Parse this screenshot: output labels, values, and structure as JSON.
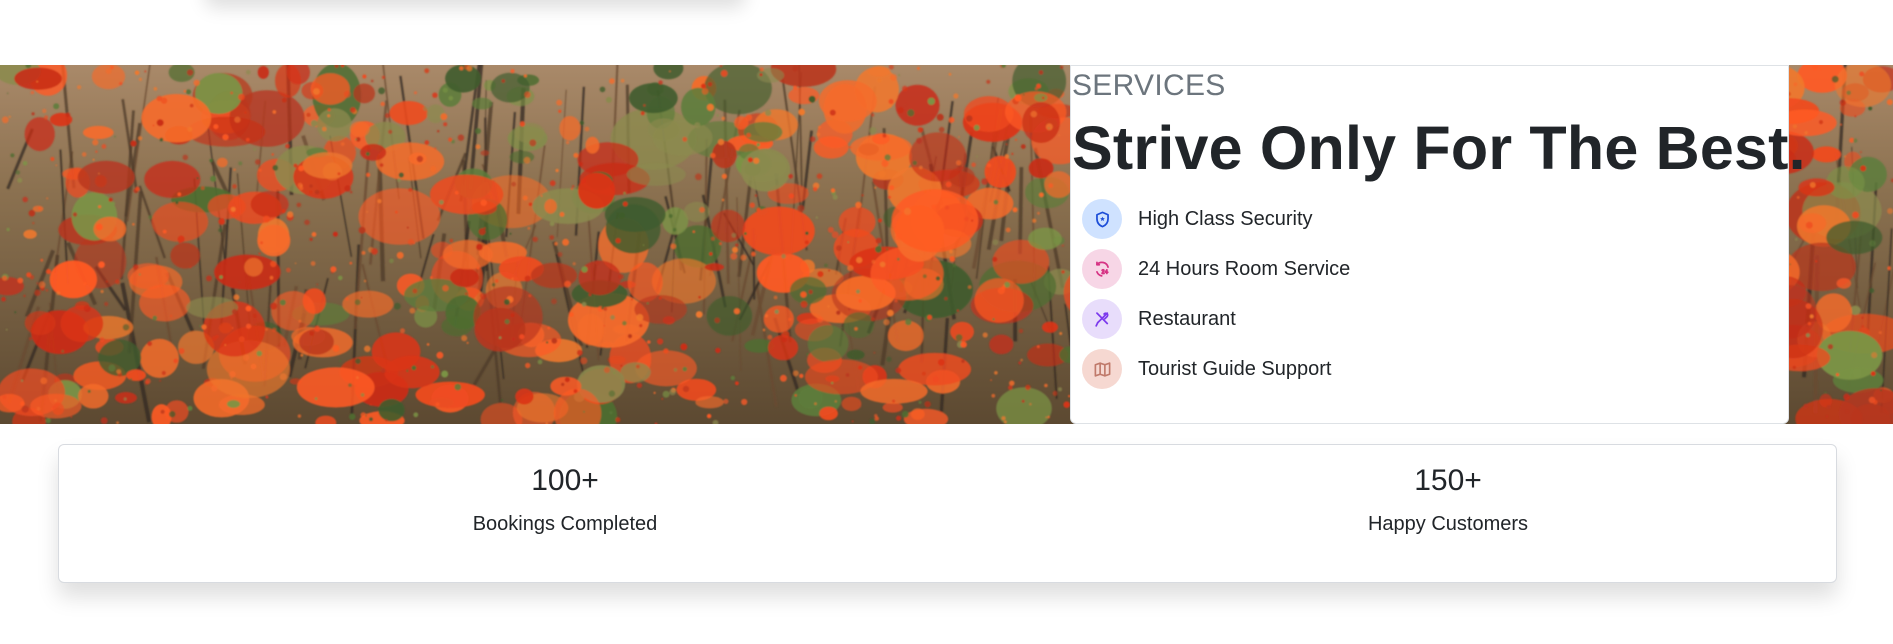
{
  "hero": {
    "image_description_icon": "flowering-forest-image"
  },
  "services": {
    "kicker": "SERVICES",
    "title": "Strive Only For The Best.",
    "items": [
      {
        "label": "High Class Security",
        "icon": "shield-star-icon",
        "icon_color": "#1d4ed8",
        "icon_bg": "#cfe2ff"
      },
      {
        "label": "24 Hours Room Service",
        "icon": "24-hour-service-icon",
        "icon_color": "#d63384",
        "icon_bg": "#f7d6e6"
      },
      {
        "label": "Restaurant",
        "icon": "restaurant-utensils-icon",
        "icon_color": "#7c3aed",
        "icon_bg": "#e8ddfb"
      },
      {
        "label": "Tourist Guide Support",
        "icon": "map-icon",
        "icon_color": "#c07a6b",
        "icon_bg": "#f6d8d1"
      }
    ]
  },
  "stats": [
    {
      "value": "100+",
      "label": "Bookings Completed"
    },
    {
      "value": "150+",
      "label": "Happy Customers"
    }
  ],
  "colors": {
    "text_dark": "#212529",
    "text_muted": "#6c757d",
    "foliage_red": "#e8421b",
    "foliage_green": "#4d7434"
  }
}
